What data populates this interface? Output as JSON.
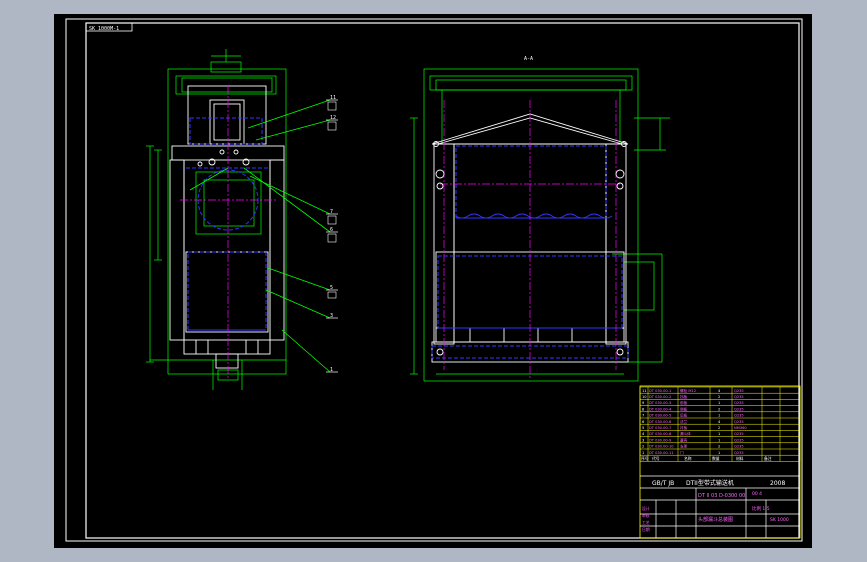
{
  "drawing": {
    "background": "#000000",
    "frame_color": "#ffffff",
    "view_line_color": "#ffffff",
    "dimension_color": "#00ff00",
    "hidden_line_color": "#3333ff",
    "center_line_color": "#ff00ff",
    "table_color": "#ffff00",
    "app_background": "#aeb7c3"
  },
  "corner_label": "SK 1000M-1",
  "section_label": "A-A",
  "title_block": {
    "standard": "GB/T JB",
    "product": "DTII型带式输送机",
    "year": "2008",
    "drawing_no": "DT II 03 D-0300 00",
    "weight_label": "00 4",
    "scale_label": "比例 1:5",
    "part_name": "头部漏斗总装图",
    "company": "SK 1000",
    "notes": [
      "设计",
      "审核",
      "工艺",
      "日期"
    ]
  },
  "parts_list_rows": [
    {
      "code": "DT 030.00-1",
      "name": "螺栓 M12",
      "qty": "4",
      "mat": "Q235"
    },
    {
      "code": "DT 030.00-2",
      "name": "挡板",
      "qty": "2",
      "mat": "Q235"
    },
    {
      "code": "DT 030.00-3",
      "name": "前板",
      "qty": "1",
      "mat": "Q235"
    },
    {
      "code": "DT 030.00-4",
      "name": "侧板",
      "qty": "2",
      "mat": "Q235"
    },
    {
      "code": "DT 030.00-5",
      "name": "后板",
      "qty": "1",
      "mat": "Q235"
    },
    {
      "code": "DT 030.00-6",
      "name": "法兰",
      "qty": "4",
      "mat": "Q235"
    },
    {
      "code": "DT 030.00-7",
      "name": "衬板",
      "qty": "2",
      "mat": "NM360"
    },
    {
      "code": "DT 030.00-8",
      "name": "漏斗体",
      "qty": "1",
      "mat": "Q235"
    },
    {
      "code": "DT 030.00-9",
      "name": "罩壳",
      "qty": "1",
      "mat": "Q235"
    },
    {
      "code": "DT 030.00-10",
      "name": "支架",
      "qty": "2",
      "mat": "Q235"
    },
    {
      "code": "DT 030.00-11",
      "name": "门",
      "qty": "1",
      "mat": "Q235"
    }
  ],
  "header_row": [
    "序号",
    "代号",
    "名称",
    "数量",
    "材料",
    "备注"
  ],
  "balloons": [
    "11",
    "12",
    "7",
    "6",
    "5",
    "3",
    "1"
  ]
}
